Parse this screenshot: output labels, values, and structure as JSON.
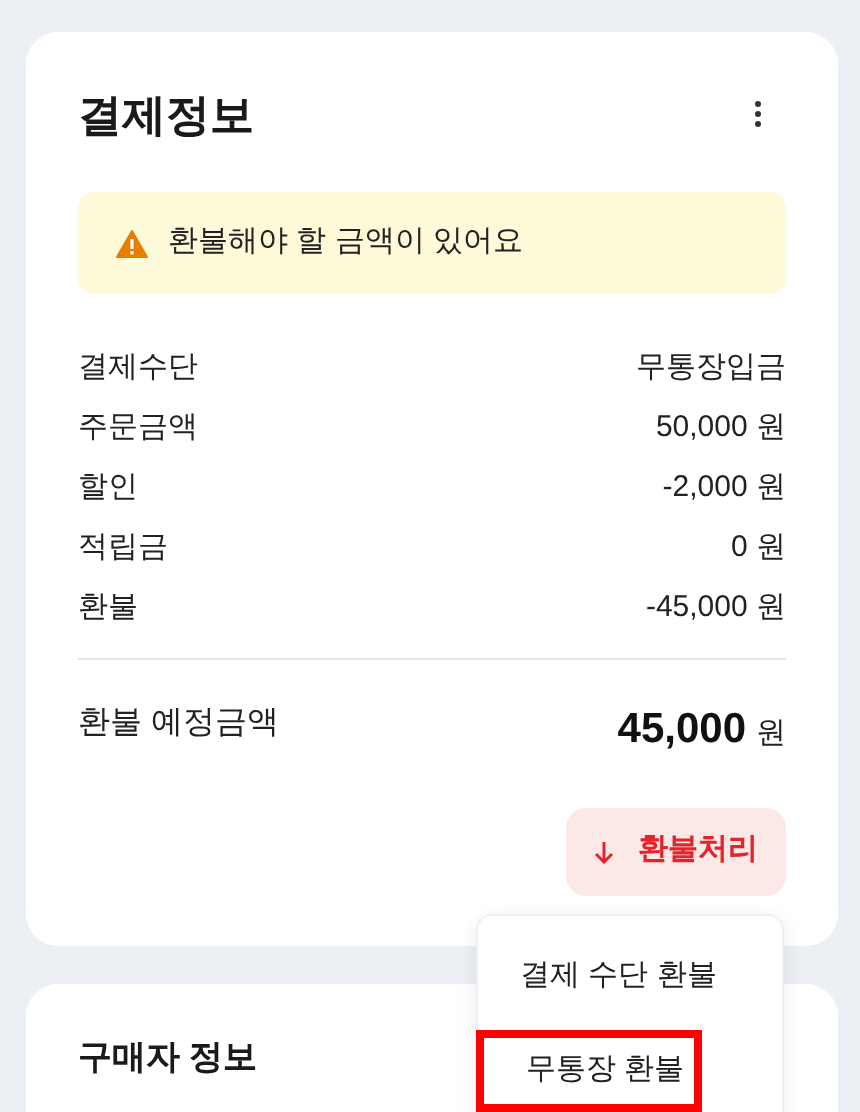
{
  "payment_card": {
    "title": "결제정보",
    "alert": {
      "text": "환불해야 할 금액이 있어요"
    },
    "rows": [
      {
        "label": "결제수단",
        "value": "무통장입금"
      },
      {
        "label": "주문금액",
        "value": "50,000 원"
      },
      {
        "label": "할인",
        "value": "-2,000 원"
      },
      {
        "label": "적립금",
        "value": "0 원"
      },
      {
        "label": "환불",
        "value": "-45,000 원"
      }
    ],
    "total": {
      "label": "환불 예정금액",
      "amount": "45,000",
      "unit": "원"
    },
    "refund_button": {
      "label": "환불처리"
    }
  },
  "refund_menu": {
    "items": [
      {
        "label": "결제 수단 환불",
        "selected": false
      },
      {
        "label": "무통장 환불",
        "selected": true
      }
    ]
  },
  "buyer_card": {
    "title": "구매자 정보"
  }
}
